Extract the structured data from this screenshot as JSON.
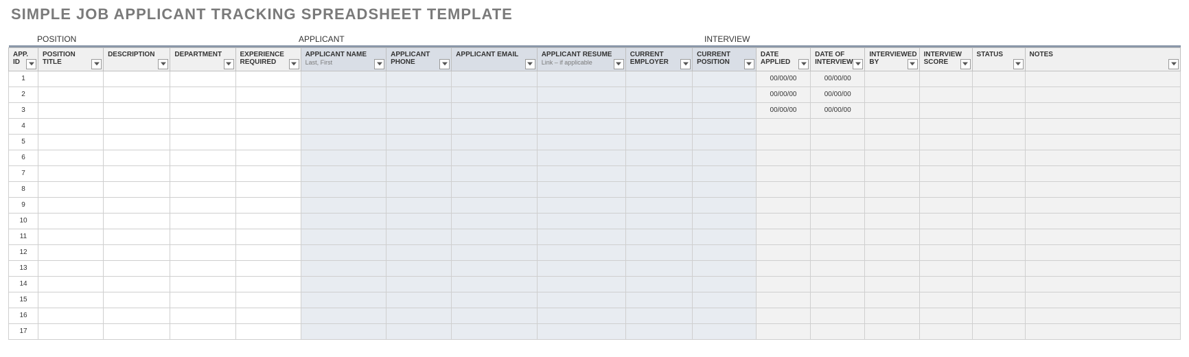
{
  "title": "SIMPLE JOB APPLICANT TRACKING SPREADSHEET TEMPLATE",
  "sections": {
    "position": "POSITION",
    "applicant": "APPLICANT",
    "interview": "INTERVIEW"
  },
  "headers": {
    "app_id": "APP. ID",
    "position_title": "POSITION TITLE",
    "description": "DESCRIPTION",
    "department": "DEPARTMENT",
    "experience_required": "EXPERIENCE REQUIRED",
    "applicant_name": "APPLICANT NAME",
    "applicant_name_sub": "Last, First",
    "applicant_phone": "APPLICANT PHONE",
    "applicant_email": "APPLICANT EMAIL",
    "applicant_resume": "APPLICANT RESUME",
    "applicant_resume_sub": "Link – if applicable",
    "current_employer": "CURRENT EMPLOYER",
    "current_position": "CURRENT POSITION",
    "date_applied": "DATE APPLIED",
    "date_of_interview": "DATE OF INTERVIEW",
    "interviewed_by": "INTERVIEWED BY",
    "interview_score": "INTERVIEW SCORE",
    "status": "STATUS",
    "notes": "NOTES"
  },
  "rows": [
    {
      "app_id": "1",
      "date_applied": "00/00/00",
      "date_of_interview": "00/00/00"
    },
    {
      "app_id": "2",
      "date_applied": "00/00/00",
      "date_of_interview": "00/00/00"
    },
    {
      "app_id": "3",
      "date_applied": "00/00/00",
      "date_of_interview": "00/00/00"
    },
    {
      "app_id": "4"
    },
    {
      "app_id": "5"
    },
    {
      "app_id": "6"
    },
    {
      "app_id": "7"
    },
    {
      "app_id": "8"
    },
    {
      "app_id": "9"
    },
    {
      "app_id": "10"
    },
    {
      "app_id": "11"
    },
    {
      "app_id": "12"
    },
    {
      "app_id": "13"
    },
    {
      "app_id": "14"
    },
    {
      "app_id": "15"
    },
    {
      "app_id": "16"
    },
    {
      "app_id": "17"
    }
  ]
}
